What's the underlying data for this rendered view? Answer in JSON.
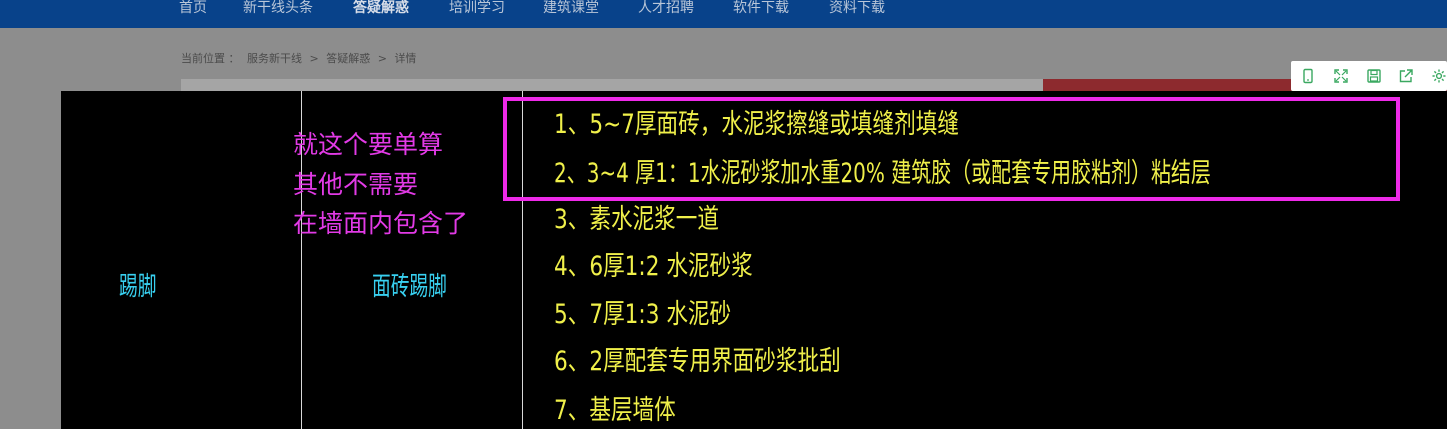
{
  "nav": {
    "items": [
      "首页",
      "新干线头条",
      "答疑解惑",
      "培训学习",
      "建筑课堂",
      "人才招聘",
      "软件下载",
      "资料下载"
    ],
    "active_index": 2
  },
  "breadcrumb": {
    "prefix": "当前位置 ：",
    "items": [
      "服务新干线",
      "答疑解惑",
      "详情"
    ],
    "separator": ">"
  },
  "toolbar": {
    "icons": [
      "phone-icon",
      "fullscreen-icon",
      "save-icon",
      "share-icon",
      "settings-icon"
    ]
  },
  "cad": {
    "col1_label": "踢脚",
    "col2_label": "面砖踢脚",
    "note_lines": [
      "就这个要单算",
      "其他不需要",
      "在墙面内包含了"
    ],
    "layers": [
      "1、5~7厚面砖，水泥浆擦缝或填缝剂填缝",
      "2、3~4 厚1：1水泥砂浆加水重20% 建筑胶（或配套专用胶粘剂）粘结层",
      "3、素水泥浆一道",
      "4、6厚1:2 水泥砂浆",
      "5、7厚1:3 水泥砂",
      "6、2厚配套专用界面砂浆批刮",
      "7、基层墙体"
    ]
  },
  "colors": {
    "nav_bg": "#08428a",
    "cad_bg": "#000000",
    "label_cyan": "#38d0f0",
    "note_magenta": "#e23ae6",
    "layer_yellow": "#f0f04a",
    "highlight": "#ee2ae8"
  }
}
